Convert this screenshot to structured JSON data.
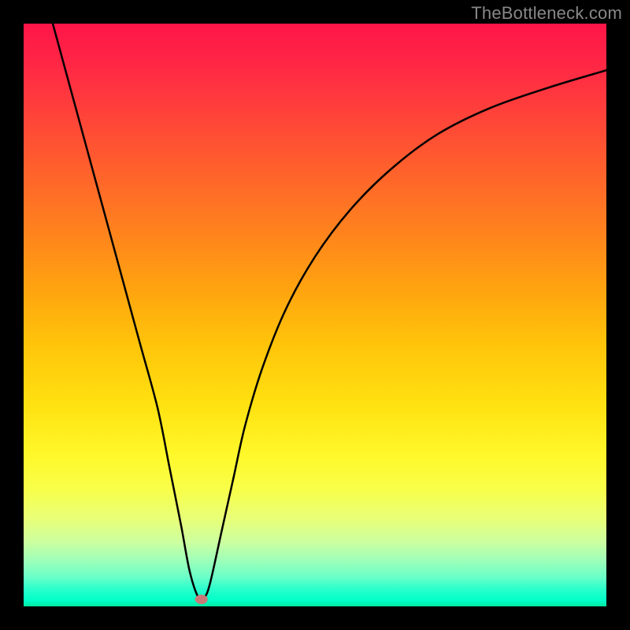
{
  "watermark": "TheBottleneck.com",
  "chart_data": {
    "type": "line",
    "title": "",
    "xlabel": "",
    "ylabel": "",
    "xlim": [
      0,
      100
    ],
    "ylim": [
      0,
      100
    ],
    "x": [
      5,
      8,
      11,
      14,
      17,
      20,
      23,
      25,
      27,
      28.5,
      30,
      31,
      32,
      34,
      36,
      38,
      41,
      45,
      50,
      56,
      63,
      71,
      80,
      90,
      100
    ],
    "y": [
      100,
      89,
      78,
      67,
      56,
      45,
      34,
      24,
      14,
      6,
      1.5,
      1.5,
      4,
      13,
      22,
      31,
      41,
      51,
      60,
      68,
      75,
      81,
      85.5,
      89,
      92
    ],
    "marker_point": {
      "x": 30.5,
      "y": 1.2
    },
    "gradient_description": "red-yellow-green vertical"
  }
}
